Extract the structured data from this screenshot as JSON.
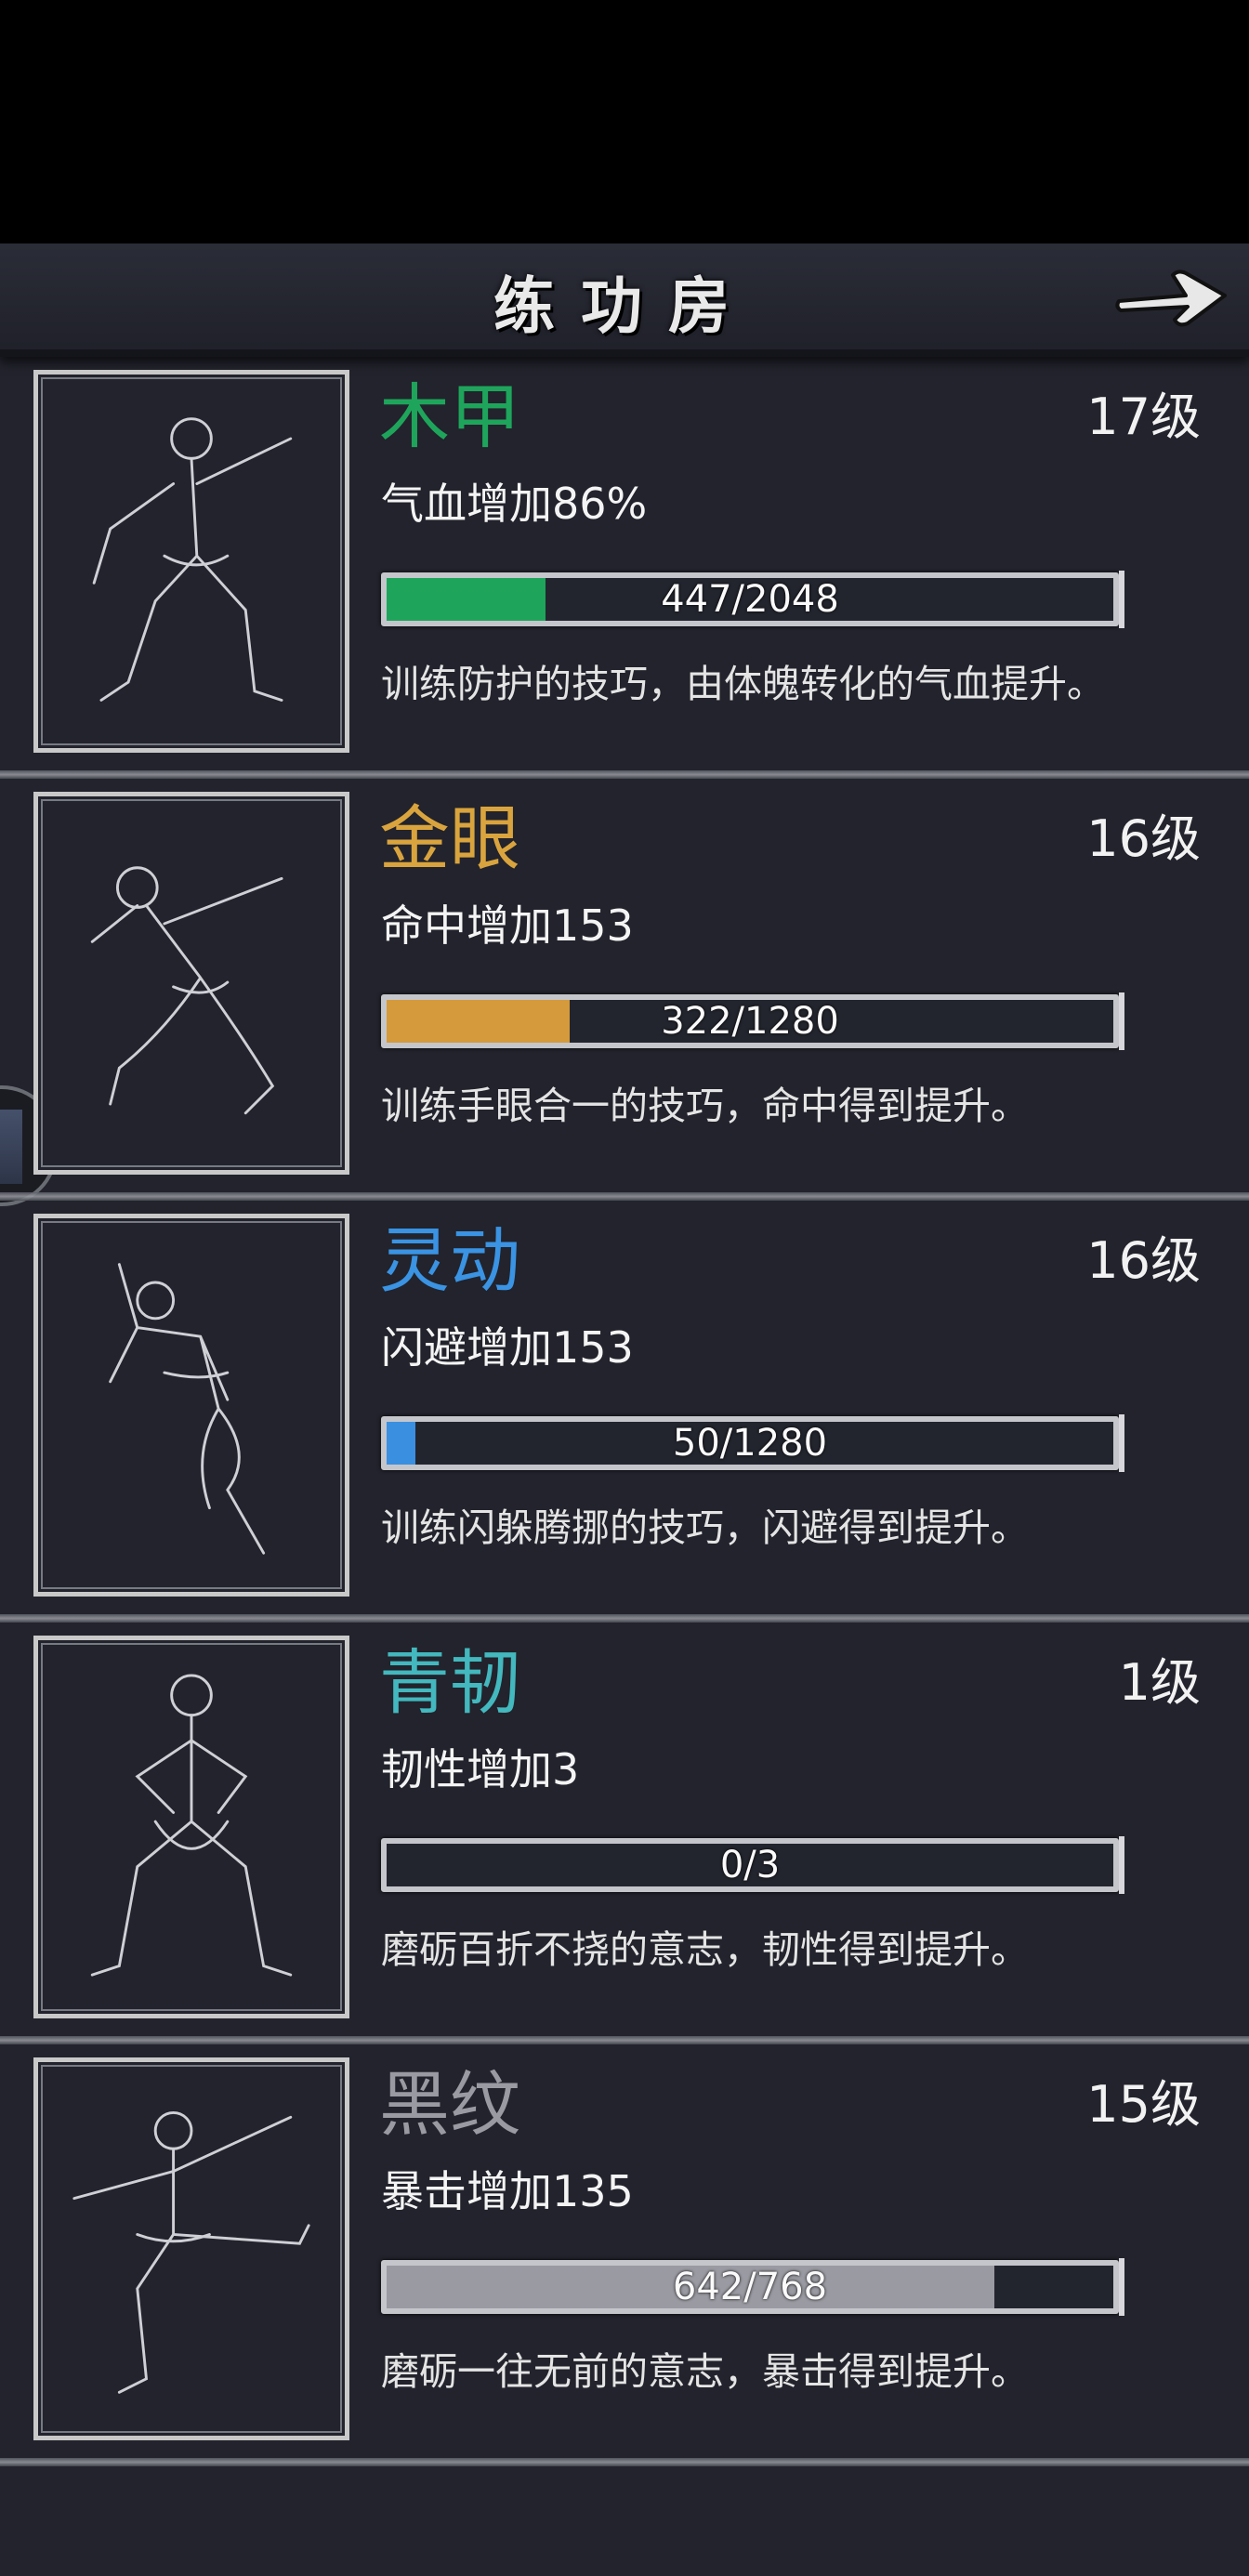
{
  "header": {
    "title": "练功房",
    "next_icon": "right-arrow-icon"
  },
  "skills": [
    {
      "name": "木甲",
      "name_color": "#1ea55b",
      "level": "17级",
      "bonus": "气血增加86%",
      "progress_text": "447/2048",
      "progress": 0.2183,
      "bar_color": "#1ea55b",
      "description": "训练防护的技巧，由体魄转化的气血提升。"
    },
    {
      "name": "金眼",
      "name_color": "#d9a43e",
      "level": "16级",
      "bonus": "命中增加153",
      "progress_text": "322/1280",
      "progress": 0.2516,
      "bar_color": "#d49a3c",
      "description": "训练手眼合一的技巧，命中得到提升。"
    },
    {
      "name": "灵动",
      "name_color": "#3a93e3",
      "level": "16级",
      "bonus": "闪避增加153",
      "progress_text": "50/1280",
      "progress": 0.0391,
      "bar_color": "#3a8fe0",
      "description": "训练闪躲腾挪的技巧，闪避得到提升。"
    },
    {
      "name": "青韧",
      "name_color": "#43b8be",
      "level": "1级",
      "bonus": "韧性增加3",
      "progress_text": "0/3",
      "progress": 0,
      "bar_color": "#43b8be",
      "description": "磨砺百折不挠的意志，韧性得到提升。"
    },
    {
      "name": "黑纹",
      "name_color": "#9a9aa2",
      "level": "15级",
      "bonus": "暴击增加135",
      "progress_text": "642/768",
      "progress": 0.8359,
      "bar_color": "#9a9aa2",
      "description": "磨砺一往无前的意志，暴击得到提升。"
    }
  ]
}
